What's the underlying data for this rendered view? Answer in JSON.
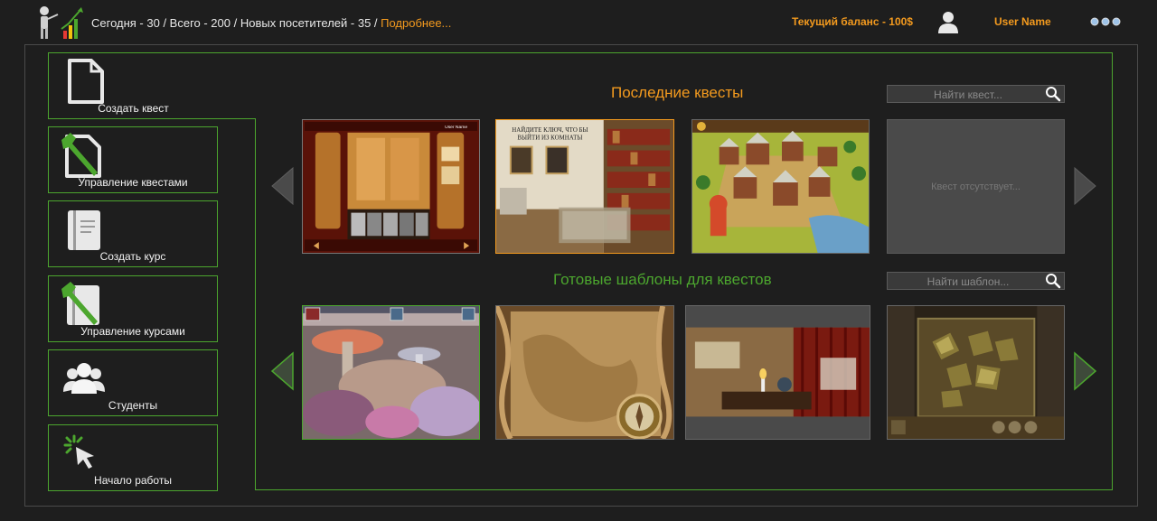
{
  "header": {
    "stats_text": "Сегодня - 30 / Всего - 200 / Новых посетителей - 35 / ",
    "more_link": "Подробнее...",
    "balance": "Текущий баланс - 100$",
    "user_name": "User Name"
  },
  "sidebar": {
    "items": [
      {
        "label": "Создать квест",
        "icon": "document-icon",
        "active": true
      },
      {
        "label": "Управление квестами",
        "icon": "document-wrench-icon"
      },
      {
        "label": "Создать курс",
        "icon": "book-icon"
      },
      {
        "label": "Управление курсами",
        "icon": "book-wrench-icon"
      },
      {
        "label": "Студенты",
        "icon": "users-icon"
      },
      {
        "label": "Начало работы",
        "icon": "cursor-click-icon"
      }
    ]
  },
  "recent": {
    "title": "Последние квесты",
    "search_placeholder": "Найти квест...",
    "empty_text": "Квест отсутствует...",
    "thumb1_header": "User Name",
    "thumb2_caption_line1": "НАЙДИТЕ КЛЮЧ, ЧТО БЫ",
    "thumb2_caption_line2": "ВЫЙТИ ИЗ КОМНАТЫ"
  },
  "templates": {
    "title": "Готовые шаблоны для квестов",
    "search_placeholder": "Найти шаблон..."
  },
  "colors": {
    "accent_orange": "#f39a1e",
    "accent_green": "#4ca62e",
    "background": "#1e1e1e"
  }
}
